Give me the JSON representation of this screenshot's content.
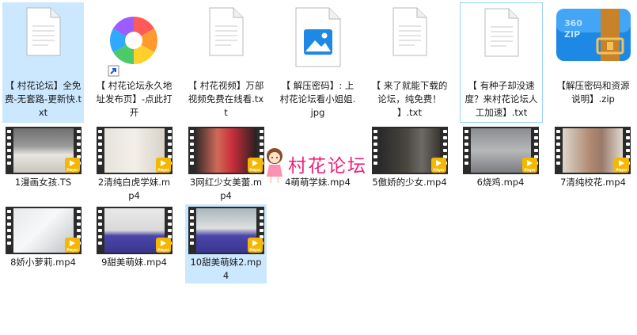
{
  "files_row1": [
    {
      "name": "【 村花论坛】全免费-无套路-更新快.txt",
      "type": "txt"
    },
    {
      "name": "【 村花论坛永久地址发布页】-点此打开",
      "type": "shortcut"
    },
    {
      "name": "【 村花视频】万部视频免费在线看.txt",
      "type": "txt"
    },
    {
      "name": "【 解压密码】: 上村花论坛看小姐姐.jpg",
      "type": "jpg"
    },
    {
      "name": "【 来了就能下载的论坛，纯免费！ 】.txt",
      "type": "txt"
    },
    {
      "name": "【 有种子却没速度？来村花论坛人工加速】.txt",
      "type": "txt"
    },
    {
      "name": "【解压密码和资源说明】.zip",
      "type": "zip"
    }
  ],
  "files_row2": [
    {
      "name": "1漫画女孩.TS"
    },
    {
      "name": "2清纯白虎学妹.mp4"
    },
    {
      "name": "3网红少女美蕾.mp4"
    },
    {
      "name": "4萌萌学妹.mp4"
    },
    {
      "name": "5傲娇的少女.mp4"
    },
    {
      "name": "6烧鸡.mp4"
    },
    {
      "name": "7清纯校花.mp4"
    }
  ],
  "files_row3": [
    {
      "name": "8娇小萝莉.mp4"
    },
    {
      "name": "9甜美萌妹.mp4"
    },
    {
      "name": "10甜美萌妹2.mp4"
    }
  ],
  "badge_text": "Player",
  "zip_icon_text": "360\nZIP",
  "watermark_text": "村花论坛",
  "colors": {
    "selection": "#cce8ff",
    "badge": "#f5b800",
    "watermark": "#f0207a",
    "zip_blue": "#1e88e5",
    "zip_belt": "#c8832a"
  }
}
